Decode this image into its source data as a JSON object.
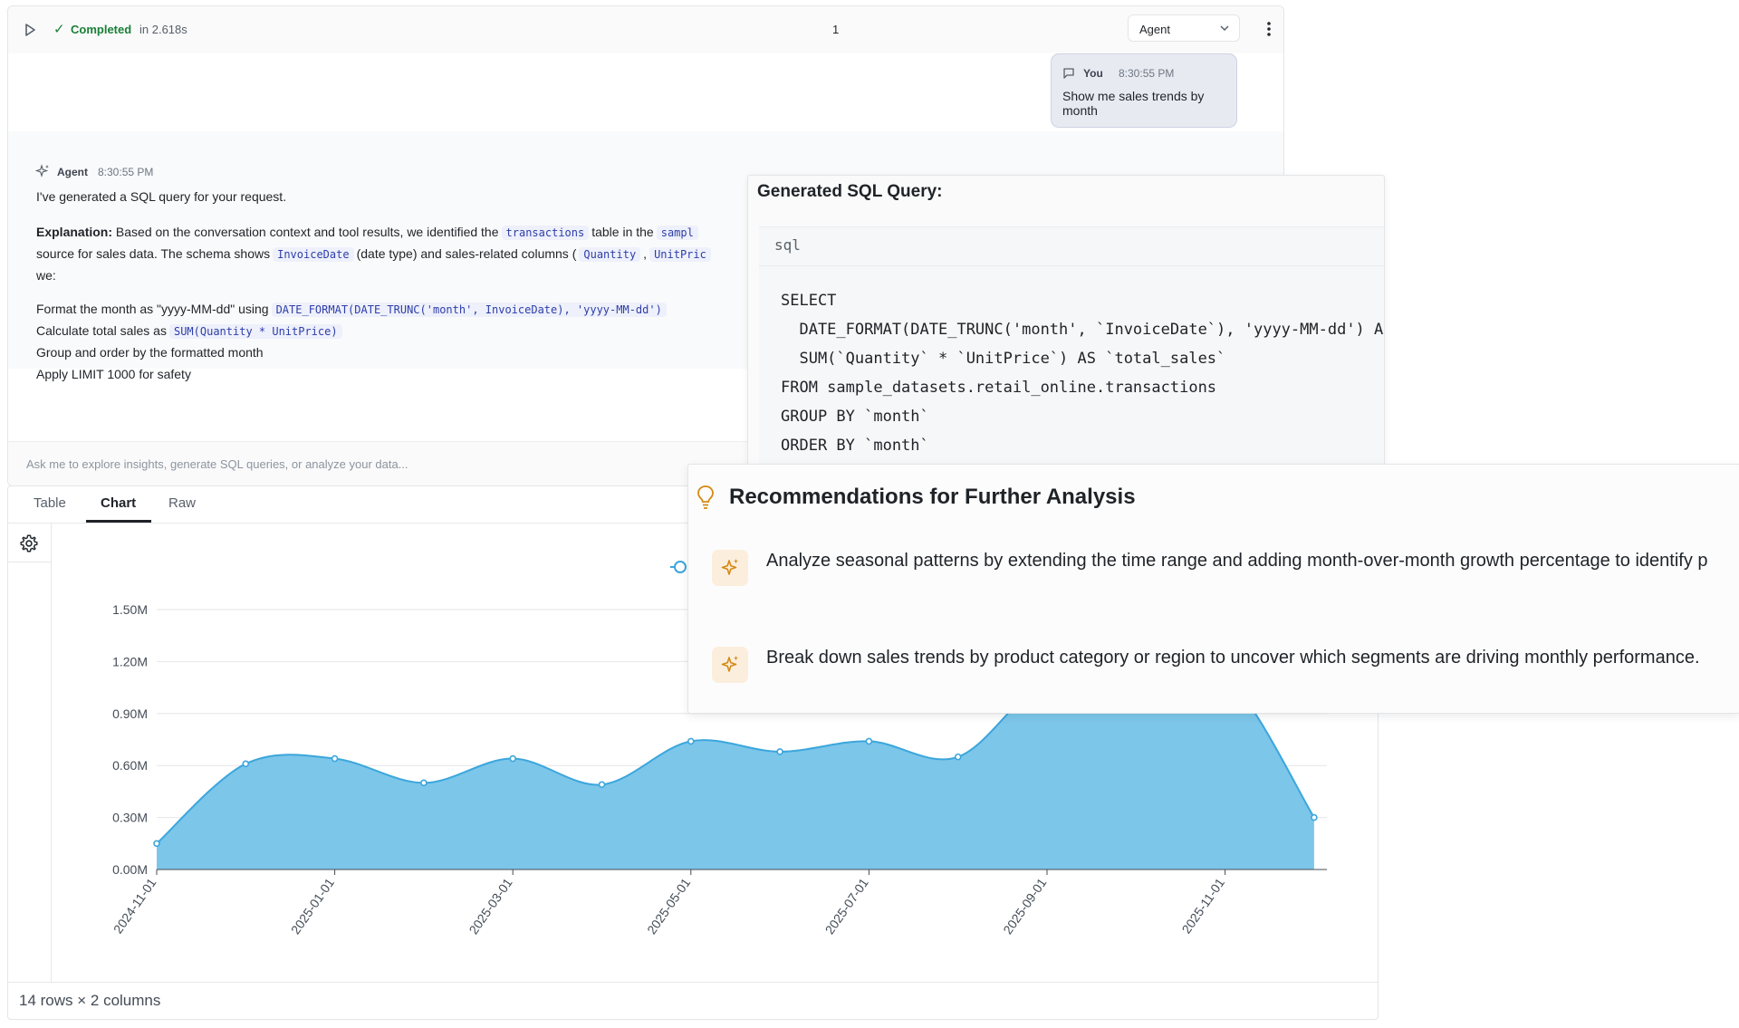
{
  "header": {
    "run_icon": "play-icon",
    "status_label": "Completed",
    "status_time": "in 2.618s",
    "cell_number": "1",
    "mode": "Agent"
  },
  "user_message": {
    "name": "You",
    "time": "8:30:55 PM",
    "text": "Show me sales trends by month"
  },
  "agent_message": {
    "name": "Agent",
    "time": "8:30:55 PM",
    "intro": "I've generated a SQL query for your request.",
    "explanation_label": "Explanation:",
    "explanation_a": " Based on the conversation context and tool results, we identified the",
    "chip_transactions": "transactions",
    "explanation_b": "table in the",
    "chip_sampl": "sampl",
    "line2_a": "source for sales data. The schema shows",
    "chip_invoicedate": "InvoiceDate",
    "line2_b": "(date type) and sales-related columns (",
    "chip_quantity": "Quantity",
    "line2_comma": ",",
    "chip_unitpric": "UnitPric",
    "line3": "we:",
    "step1": "Format the month as \"yyyy-MM-dd\" using",
    "step1_chip": "DATE_FORMAT(DATE_TRUNC('month', InvoiceDate), 'yyyy-MM-dd')",
    "step2": "Calculate total sales as",
    "step2_chip": "SUM(Quantity * UnitPrice)",
    "step3": "Group and order by the formatted month",
    "step4": "Apply LIMIT 1000 for safety"
  },
  "chat_input": {
    "placeholder": "Ask me to explore insights, generate SQL queries, or analyze your data..."
  },
  "tabs": [
    {
      "label": "Table"
    },
    {
      "label": "Chart"
    },
    {
      "label": "Raw"
    }
  ],
  "active_tab": "Chart",
  "footer": {
    "row_count": "14 rows × 2 columns"
  },
  "sql": {
    "title": "Generated SQL Query:",
    "language": "sql",
    "code": "SELECT\n  DATE_FORMAT(DATE_TRUNC('month', `InvoiceDate`), 'yyyy-MM-dd') AS\n  SUM(`Quantity` * `UnitPrice`) AS `total_sales`\nFROM sample_datasets.retail_online.transactions\nGROUP BY `month`\nORDER BY `month`"
  },
  "recommendations": {
    "title": "Recommendations for Further Analysis",
    "items": [
      {
        "text": "Analyze seasonal patterns by extending the time range and adding month-over-month growth percentage to identify p"
      },
      {
        "text": "Break down sales trends by product category or region to uncover which segments are driving monthly performance."
      }
    ]
  },
  "colors": {
    "accent_green": "#1a7f37",
    "area_fill": "#7cc6ea",
    "area_line": "#3ba6dc",
    "rec_icon": "#d48a14"
  },
  "chart_data": {
    "type": "area",
    "x": [
      "2024-11-01",
      "2024-12-01",
      "2025-01-01",
      "2025-02-01",
      "2025-03-01",
      "2025-04-01",
      "2025-05-01",
      "2025-06-01",
      "2025-07-01",
      "2025-08-01",
      "2025-09-01",
      "2025-10-01",
      "2025-11-01",
      "2025-12-01"
    ],
    "values": [
      0.15,
      0.61,
      0.64,
      0.5,
      0.64,
      0.49,
      0.74,
      0.68,
      0.74,
      0.65,
      1.1,
      1.15,
      1.12,
      0.3
    ],
    "x_ticks": [
      "2024-11-01",
      "2025-01-01",
      "2025-03-01",
      "2025-05-01",
      "2025-07-01",
      "2025-09-01",
      "2025-11-01"
    ],
    "y_ticks": [
      "0.00M",
      "0.30M",
      "0.60M",
      "0.90M",
      "1.20M",
      "1.50M"
    ],
    "ylim": [
      0,
      1.5
    ],
    "grid": true
  }
}
